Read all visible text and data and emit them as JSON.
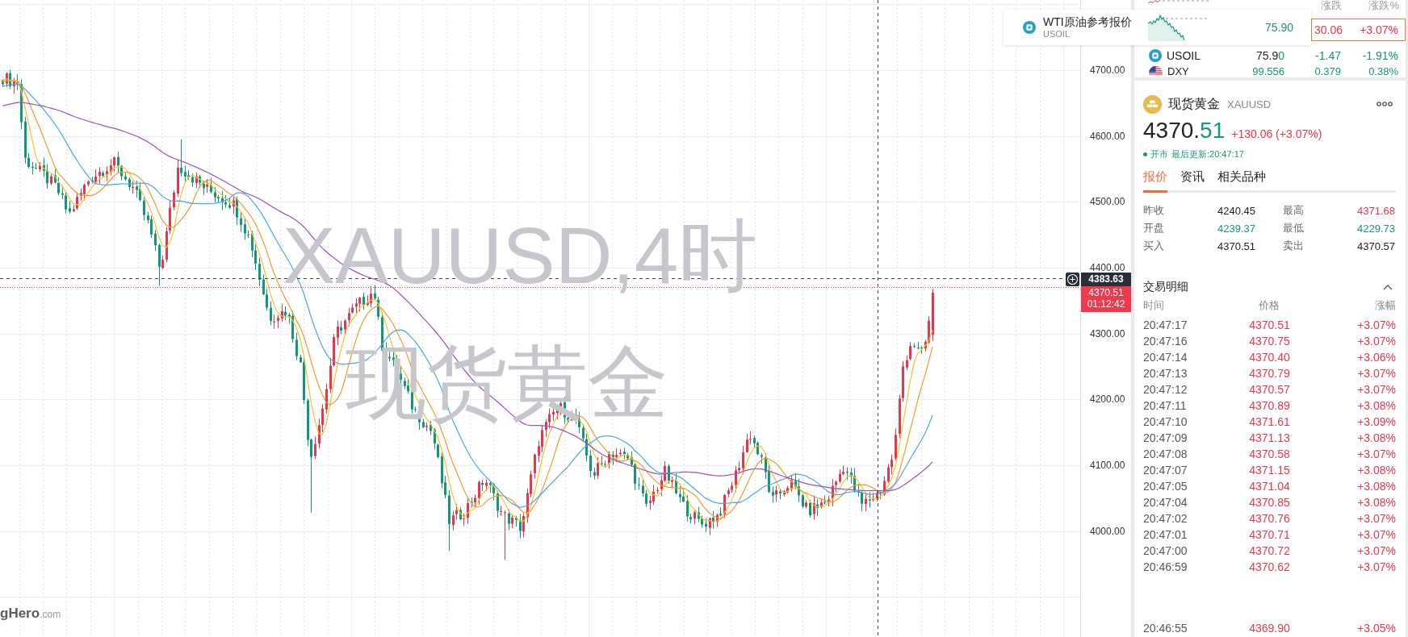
{
  "chart": {
    "watermark": {
      "symbol": "XAUUSD,4时",
      "name": "现货黄金"
    },
    "logo": "**gHero**.com"
  },
  "price_axis": {
    "labels": [
      "4700.00",
      "4600.00",
      "4500.00",
      "4400.00",
      "4300.00",
      "4200.00",
      "4100.00",
      "4000.00"
    ],
    "crosshair_price": "4383.63",
    "last_price": "4370.51",
    "countdown": "01:12:42"
  },
  "watchlist": {
    "columns": [
      "涨跌",
      "涨跌%"
    ],
    "rows": [
      {
        "kind": "covered",
        "change": "30.06",
        "change_pct": "+3.07%",
        "rising": true,
        "selected": true
      },
      {
        "kind": "commodity",
        "code": "USOIL",
        "price_lead": "75.9",
        "price_tail": "0",
        "tick_down": true,
        "change": "-1.47",
        "change_pct": "-1.91%",
        "rising": false,
        "selected": false
      },
      {
        "kind": "index",
        "code": "DXY",
        "price_tail": "99.556",
        "tick_down": true,
        "change": "0.379",
        "change_pct": "0.38%",
        "rising": false,
        "selected": false
      }
    ]
  },
  "row_tooltip": {
    "kind": "commodity",
    "name": "WTI原油参考报价",
    "code": "USOIL",
    "price_tail": "75.90",
    "tick_down": true
  },
  "quote": {
    "name": "现货黄金",
    "code": "XAUUSD",
    "price_lead": "4370.",
    "price_tail": "51",
    "tick_down": true,
    "change": "+130.06 (+3.07%)",
    "rising": true,
    "market_open": true,
    "market_status": "开市",
    "updated": "最后更新:20:47:17",
    "tabs": [
      {
        "label": "报价",
        "selected": true
      },
      {
        "label": "资讯",
        "selected": false
      },
      {
        "label": "相关品种",
        "selected": false
      }
    ],
    "stats": [
      {
        "label": "昨收",
        "value": "4240.45",
        "color": "#222222"
      },
      {
        "label": "最高",
        "value": "4371.68",
        "color": "#e5374d"
      },
      {
        "label": "开盘",
        "value": "4239.37",
        "color": "#13977b"
      },
      {
        "label": "最低",
        "value": "4229.73",
        "color": "#13977b"
      },
      {
        "label": "买入",
        "value": "4370.51",
        "color": "#222222"
      },
      {
        "label": "卖出",
        "value": "4370.57",
        "color": "#222222"
      }
    ]
  },
  "trades": {
    "title": "交易明细",
    "expanded": true,
    "columns": [
      "时间",
      "价格",
      "涨幅"
    ],
    "rows": [
      {
        "time": "20:47:17",
        "price": "4370.51",
        "change": "+3.07%",
        "rising": true
      },
      {
        "time": "20:47:16",
        "price": "4370.75",
        "change": "+3.07%",
        "rising": true
      },
      {
        "time": "20:47:14",
        "price": "4370.40",
        "change": "+3.06%",
        "rising": true
      },
      {
        "time": "20:47:13",
        "price": "4370.79",
        "change": "+3.07%",
        "rising": true
      },
      {
        "time": "20:47:12",
        "price": "4370.57",
        "change": "+3.07%",
        "rising": true
      },
      {
        "time": "20:47:11",
        "price": "4370.89",
        "change": "+3.08%",
        "rising": true
      },
      {
        "time": "20:47:10",
        "price": "4371.61",
        "change": "+3.09%",
        "rising": true
      },
      {
        "time": "20:47:09",
        "price": "4371.13",
        "change": "+3.08%",
        "rising": true
      },
      {
        "time": "20:47:08",
        "price": "4370.58",
        "change": "+3.07%",
        "rising": true
      },
      {
        "time": "20:47:07",
        "price": "4371.15",
        "change": "+3.08%",
        "rising": true
      },
      {
        "time": "20:47:05",
        "price": "4371.04",
        "change": "+3.08%",
        "rising": true
      },
      {
        "time": "20:47:04",
        "price": "4370.85",
        "change": "+3.08%",
        "rising": true
      },
      {
        "time": "20:47:02",
        "price": "4370.76",
        "change": "+3.07%",
        "rising": true
      },
      {
        "time": "20:47:01",
        "price": "4370.71",
        "change": "+3.07%",
        "rising": true
      },
      {
        "time": "20:47:00",
        "price": "4370.72",
        "change": "+3.07%",
        "rising": true
      },
      {
        "time": "20:46:59",
        "price": "4370.62",
        "change": "+3.07%",
        "rising": true
      }
    ],
    "rows_after_gap": [
      {
        "time": "20:46:55",
        "price": "4369.90",
        "change": "+3.05%",
        "rising": true
      }
    ]
  }
}
